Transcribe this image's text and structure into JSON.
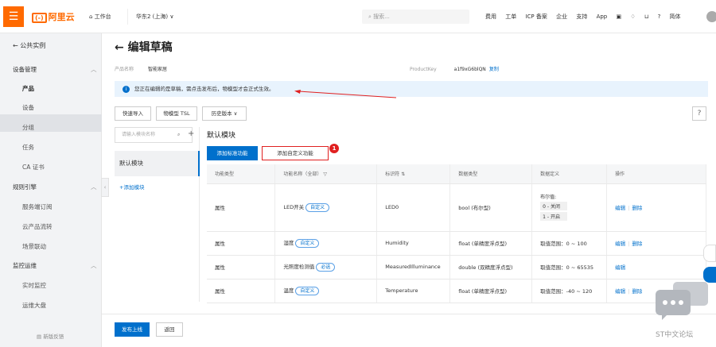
{
  "topbar": {
    "menu_icon": "menu-icon",
    "brand_bracket": "(-)",
    "brand_name": "阿里云",
    "workbench": "工作台",
    "region": "华东2 (上海)",
    "search_placeholder": "搜索...",
    "nav": [
      "费用",
      "工单",
      "ICP 备案",
      "企业",
      "支持",
      "App"
    ],
    "lang": "简体"
  },
  "sidebar": {
    "back": "公共实例",
    "groups": [
      {
        "label": "设备管理",
        "items": [
          "产品",
          "设备",
          "分组",
          "任务",
          "CA 证书"
        ]
      },
      {
        "label": "规则引擎",
        "items": [
          "服务端订阅",
          "云产品流转",
          "场景联动"
        ]
      },
      {
        "label": "监控运维",
        "items": [
          "实时监控",
          "运维大盘"
        ]
      }
    ],
    "active_item": "产品",
    "feedback": "新版反馈"
  },
  "page": {
    "title": "编辑草稿",
    "product_name_label": "产品名称",
    "product_name": "智能家居",
    "product_key_label": "ProductKey",
    "product_key": "a1f9xG6blQN",
    "copy": "复制",
    "notice": "您正在编辑的是草稿，需点击发布后，物模型才会正式生效。"
  },
  "toolbar": {
    "quick_import": "快速导入",
    "tsl": "物模型 TSL",
    "history": "历史版本",
    "help": "?"
  },
  "modules": {
    "search_placeholder": "请输入模块名称",
    "default": "默认模块",
    "add": "+添加模块"
  },
  "section": {
    "title": "默认模块",
    "add_standard": "添加标准功能",
    "add_custom": "添加自定义功能",
    "badge": "1"
  },
  "table": {
    "headers": [
      "功能类型",
      "功能名称（全部）",
      "标识符",
      "数据类型",
      "数据定义",
      "操作"
    ],
    "rows": [
      {
        "type": "属性",
        "name": "LED开关",
        "tag": "自定义",
        "id": "LED0",
        "dtype": "bool (布尔型)",
        "def_title": "布尔值:",
        "def_items": [
          "0 - 关闭",
          "1 - 开启"
        ],
        "ops": [
          "编辑",
          "删除"
        ]
      },
      {
        "type": "属性",
        "name": "湿度",
        "tag": "自定义",
        "id": "Humidity",
        "dtype": "float (单精度浮点型)",
        "def": "取值范围：0 ~ 100",
        "ops": [
          "编辑",
          "删除"
        ]
      },
      {
        "type": "属性",
        "name": "光照度检测值",
        "tag": "必选",
        "id": "MeasuredIlluminance",
        "dtype": "double (双精度浮点型)",
        "def": "取值范围：0 ~ 65535",
        "ops": [
          "编辑"
        ]
      },
      {
        "type": "属性",
        "name": "温度",
        "tag": "自定义",
        "id": "Temperature",
        "dtype": "float (单精度浮点型)",
        "def": "取值范围：-40 ~ 120",
        "ops": [
          "编辑",
          "删除"
        ]
      }
    ]
  },
  "footer": {
    "publish": "发布上线",
    "back": "返回"
  },
  "watermark": "ST中文论坛"
}
